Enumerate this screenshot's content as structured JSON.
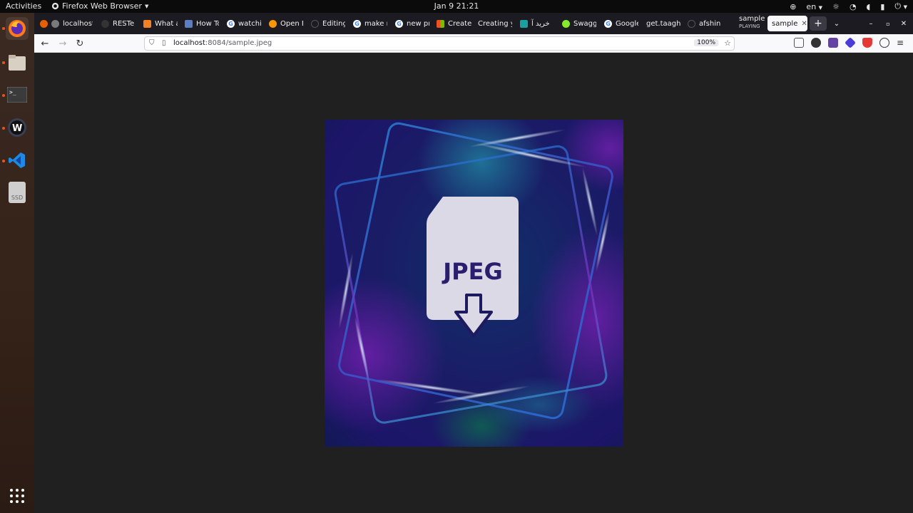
{
  "topbar": {
    "activities": "Activities",
    "app_name": "Firefox Web Browser",
    "clock": "Jan 9  21:21",
    "lang": "en"
  },
  "tabs": [
    {
      "label": "localhost",
      "icon": "firefox-icon"
    },
    {
      "label": "RESTe",
      "icon": "github-icon"
    },
    {
      "label": "What a",
      "icon": "stack-icon"
    },
    {
      "label": "How To",
      "icon": "tutorial-icon"
    },
    {
      "label": "watchi",
      "icon": "google-icon"
    },
    {
      "label": "Open E",
      "icon": "open-icon"
    },
    {
      "label": "Editing",
      "icon": "github-icon"
    },
    {
      "label": "make r",
      "icon": "google-icon"
    },
    {
      "label": "new pr",
      "icon": "google-icon"
    },
    {
      "label": "Create",
      "icon": "microsoft-icon"
    },
    {
      "label": "Creating y",
      "icon": "page-icon"
    },
    {
      "label": "خرید آ",
      "icon": "shop-icon"
    },
    {
      "label": "Swagg",
      "icon": "swagger-icon"
    },
    {
      "label": "Google",
      "icon": "google-icon"
    },
    {
      "label": "get.taagh",
      "icon": "page-icon"
    },
    {
      "label": "afshin",
      "icon": "github-icon"
    },
    {
      "label": "sample",
      "sub": "PLAYING",
      "icon": "page-icon"
    },
    {
      "label": "sample",
      "icon": "page-icon",
      "active": true
    }
  ],
  "navbar": {
    "url_host": "localhost",
    "url_rest": ":8084/sample.jpeg",
    "zoom": "100%"
  },
  "image": {
    "label": "JPEG"
  },
  "dock": {
    "ssd_label": "SSD"
  }
}
